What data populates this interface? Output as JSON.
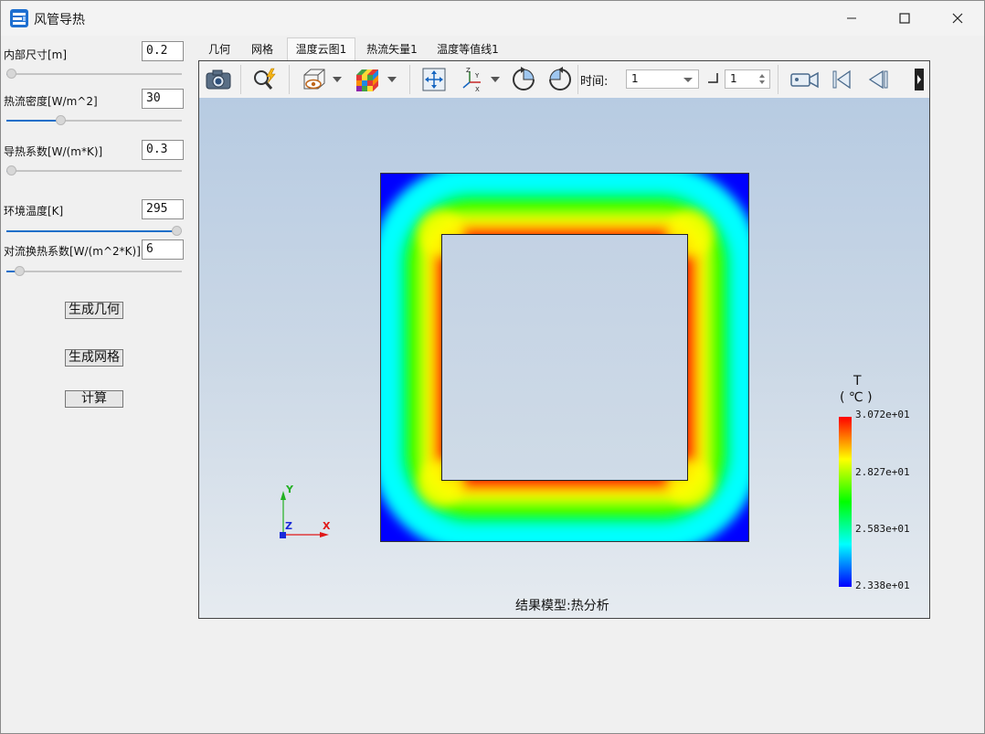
{
  "window": {
    "title": "风管导热"
  },
  "params": [
    {
      "label": "内部尺寸[m]",
      "value": "0.2",
      "slider": 0.0
    },
    {
      "label": "热流密度[W/m^2]",
      "value": "30",
      "slider": 0.3
    },
    {
      "label": "导热系数[W/(m*K)]",
      "value": "0.3",
      "slider": 0.0
    },
    {
      "label": "环境温度[K]",
      "value": "295",
      "slider": 1.0
    },
    {
      "label": "对流换热系数[W/(m^2*K)]",
      "value": "6",
      "slider": 0.05
    }
  ],
  "buttons": {
    "geometry": "生成几何",
    "mesh": "生成网格",
    "compute": "计算"
  },
  "tabs": [
    "几何",
    "网格",
    "温度云图1",
    "热流矢量1",
    "温度等值线1"
  ],
  "active_tab": 2,
  "toolbar": {
    "time_label": "时间:",
    "time_value": "1",
    "step_value": "1"
  },
  "legend": {
    "title": "T",
    "unit": "( ℃ )",
    "labels": [
      "3.072e+01",
      "2.827e+01",
      "2.583e+01",
      "2.338e+01"
    ]
  },
  "triad": {
    "x": "X",
    "y": "Y",
    "z": "Z"
  },
  "caption": "结果模型:热分析",
  "colors": {
    "accent": "#1e6fc9",
    "hot": "#ff0000",
    "cold": "#0000ff"
  }
}
